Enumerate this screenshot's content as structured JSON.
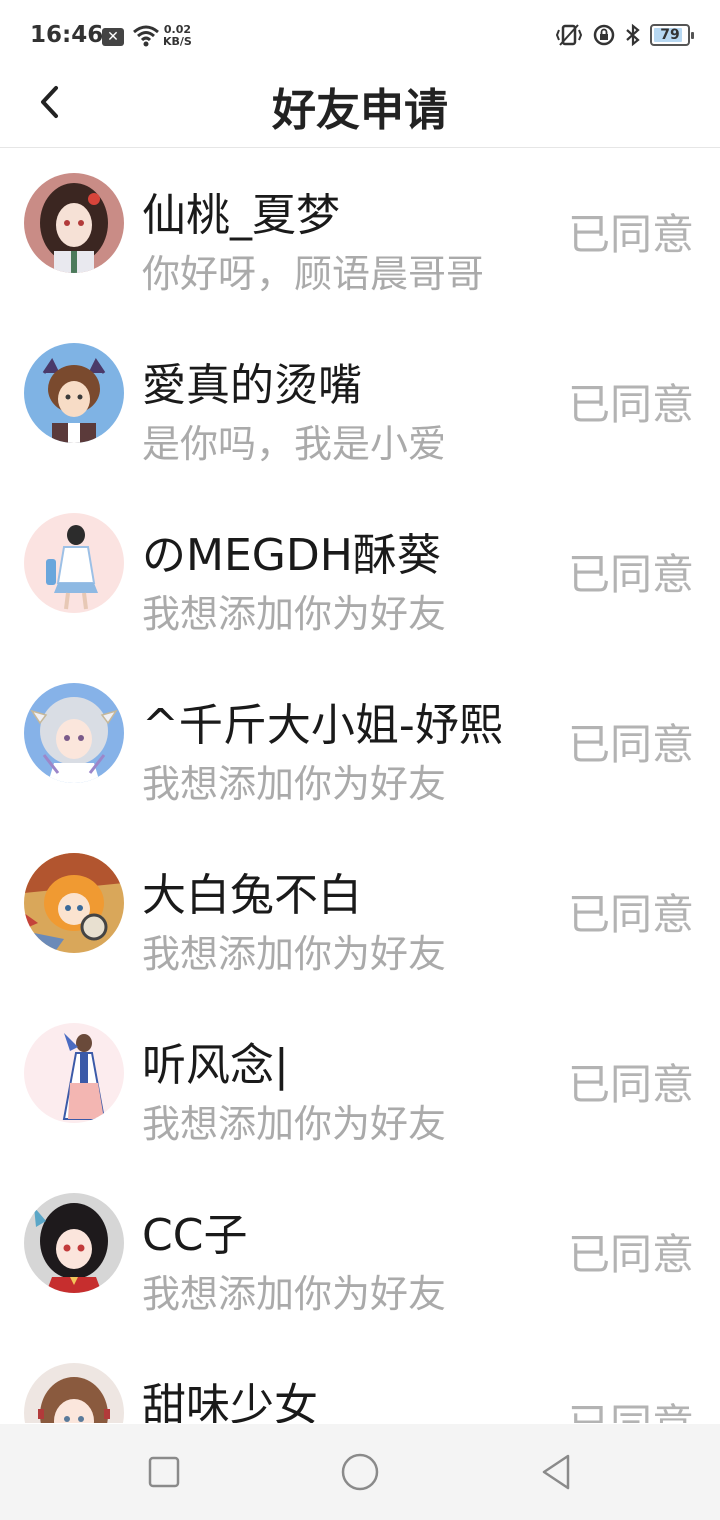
{
  "status_bar": {
    "time": "16:46",
    "net_speed_value": "0.02",
    "net_speed_unit": "KB/S",
    "battery": "79"
  },
  "header": {
    "title": "好友申请"
  },
  "requests": [
    {
      "name": "仙桃_夏梦",
      "message": "你好呀，顾语晨哥哥",
      "status": "已同意"
    },
    {
      "name": "愛真的烫嘴",
      "message": "是你吗，我是小爱",
      "status": "已同意"
    },
    {
      "name": "のMEGDH酥葵",
      "message": "我想添加你为好友",
      "status": "已同意"
    },
    {
      "name": "^千斤大小姐-妤熙",
      "message": "我想添加你为好友",
      "status": "已同意"
    },
    {
      "name": "大白兔不白",
      "message": "我想添加你为好友",
      "status": "已同意"
    },
    {
      "name": "听风念|",
      "message": "我想添加你为好友",
      "status": "已同意"
    },
    {
      "name": "CC子",
      "message": "我想添加你为好友",
      "status": "已同意"
    },
    {
      "name": "甜味少女",
      "message": "",
      "status": "已同意"
    }
  ],
  "colors": {
    "name_text": "#1a1a1a",
    "message_text": "#aaaaaa",
    "status_text": "#b3b3b3",
    "divider": "#e6e6e6",
    "navbar_bg": "#f4f4f4"
  }
}
